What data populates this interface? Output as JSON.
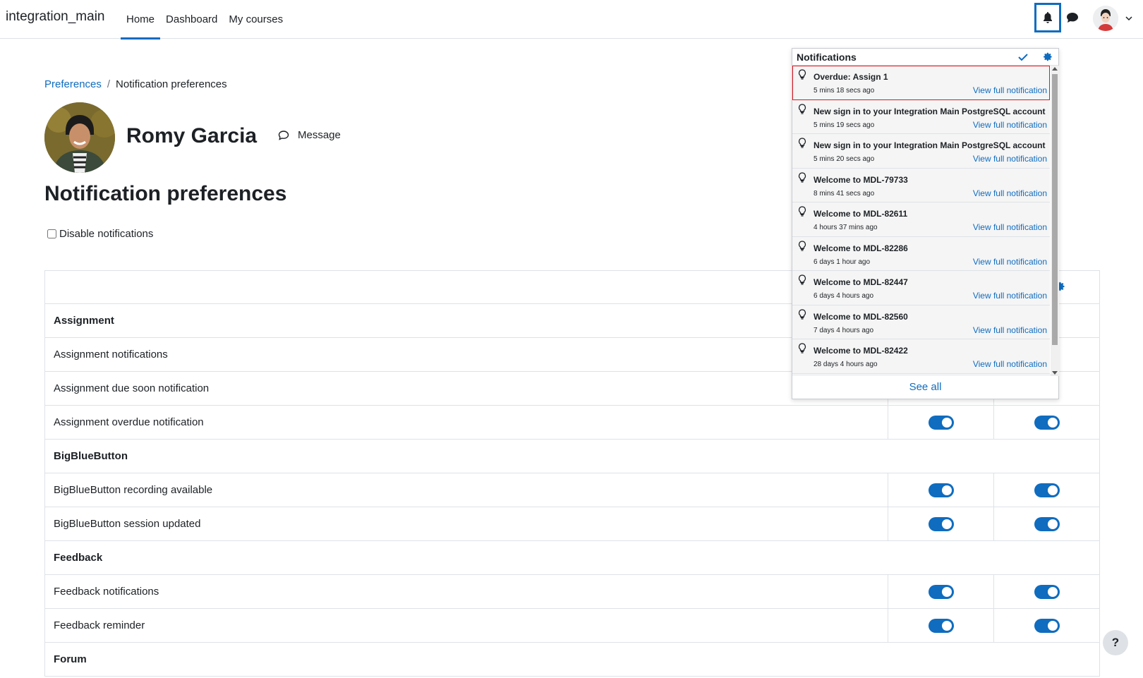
{
  "navbar": {
    "site_name": "integration_main",
    "links": [
      {
        "label": "Home",
        "active": true
      },
      {
        "label": "Dashboard",
        "active": false
      },
      {
        "label": "My courses",
        "active": false
      }
    ],
    "icons": {
      "notifications": "bell-icon",
      "messages": "chat-bubble-icon",
      "user_menu": "avatar",
      "dropdown": "chevron-down-icon"
    }
  },
  "breadcrumb": {
    "parent": "Preferences",
    "separator": "/",
    "current": "Notification preferences"
  },
  "profile": {
    "name": "Romy Garcia",
    "message_label": "Message"
  },
  "page_title": "Notification preferences",
  "disable_notifications": {
    "label": "Disable notifications",
    "checked": false
  },
  "table": {
    "rows": [
      {
        "type": "group",
        "label": "Assignment"
      },
      {
        "type": "pref",
        "label": "Assignment notifications",
        "web": true,
        "email": true
      },
      {
        "type": "pref",
        "label": "Assignment due soon notification",
        "web": true,
        "email": true
      },
      {
        "type": "pref",
        "label": "Assignment overdue notification",
        "web": true,
        "email": true
      },
      {
        "type": "group",
        "label": "BigBlueButton"
      },
      {
        "type": "pref",
        "label": "BigBlueButton recording available",
        "web": true,
        "email": true
      },
      {
        "type": "pref",
        "label": "BigBlueButton session updated",
        "web": true,
        "email": true
      },
      {
        "type": "group",
        "label": "Feedback"
      },
      {
        "type": "pref",
        "label": "Feedback notifications",
        "web": true,
        "email": true
      },
      {
        "type": "pref",
        "label": "Feedback reminder",
        "web": true,
        "email": true
      },
      {
        "type": "group",
        "label": "Forum"
      }
    ]
  },
  "notifications_popover": {
    "title": "Notifications",
    "mark_all_icon": "check-icon",
    "settings_icon": "gear-icon",
    "items": [
      {
        "title": "Overdue: Assign 1",
        "time": "5 mins 18 secs ago",
        "link": "View full notification",
        "highlighted": true
      },
      {
        "title": "New sign in to your Integration Main PostgreSQL account",
        "time": "5 mins 19 secs ago",
        "link": "View full notification",
        "highlighted": false
      },
      {
        "title": "New sign in to your Integration Main PostgreSQL account",
        "time": "5 mins 20 secs ago",
        "link": "View full notification",
        "highlighted": false
      },
      {
        "title": "Welcome to MDL-79733",
        "time": "8 mins 41 secs ago",
        "link": "View full notification",
        "highlighted": false
      },
      {
        "title": "Welcome to MDL-82611",
        "time": "4 hours 37 mins ago",
        "link": "View full notification",
        "highlighted": false
      },
      {
        "title": "Welcome to MDL-82286",
        "time": "6 days 1 hour ago",
        "link": "View full notification",
        "highlighted": false
      },
      {
        "title": "Welcome to MDL-82447",
        "time": "6 days 4 hours ago",
        "link": "View full notification",
        "highlighted": false
      },
      {
        "title": "Welcome to MDL-82560",
        "time": "7 days 4 hours ago",
        "link": "View full notification",
        "highlighted": false
      },
      {
        "title": "Welcome to MDL-82422",
        "time": "28 days 4 hours ago",
        "link": "View full notification",
        "highlighted": false
      }
    ],
    "see_all": "See all"
  },
  "help_button": "?",
  "colors": {
    "accent": "#0f6cbf",
    "highlight": "#e0161e",
    "border": "#dee2e6",
    "notif_bg": "#f5f5f5"
  }
}
